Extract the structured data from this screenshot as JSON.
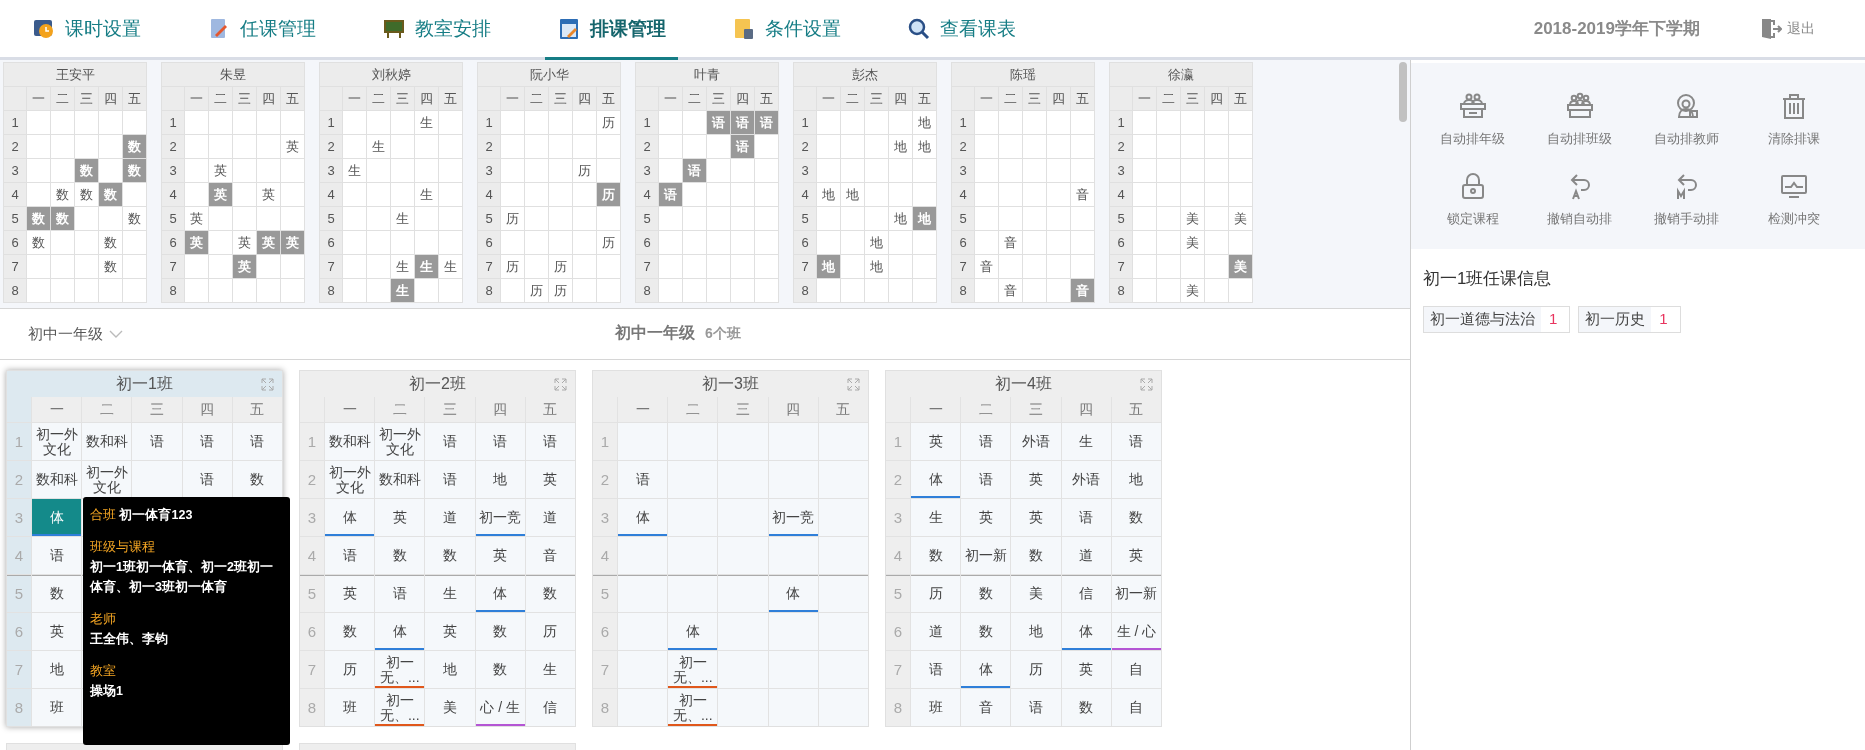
{
  "nav": {
    "tabs": [
      {
        "label": "课时设置",
        "selected": false
      },
      {
        "label": "任课管理",
        "selected": false
      },
      {
        "label": "教室安排",
        "selected": false
      },
      {
        "label": "排课管理",
        "selected": true
      },
      {
        "label": "条件设置",
        "selected": false
      },
      {
        "label": "查看课表",
        "selected": false
      }
    ],
    "term": "2018-2019学年下学期",
    "logout": "退出"
  },
  "teachers": [
    {
      "name": "王安平",
      "days": [
        "一",
        "二",
        "三",
        "四",
        "五"
      ],
      "periods": [
        "1",
        "2",
        "3",
        "4",
        "5",
        "6",
        "7",
        "8"
      ],
      "rows": [
        [
          null,
          null,
          null,
          null,
          null
        ],
        [
          null,
          null,
          null,
          null,
          {
            "text": "数",
            "highlighted": true
          }
        ],
        [
          null,
          null,
          {
            "text": "数",
            "highlighted": true
          },
          null,
          {
            "text": "数",
            "highlighted": true
          }
        ],
        [
          null,
          {
            "text": "数",
            "highlighted": false
          },
          {
            "text": "数",
            "highlighted": false
          },
          {
            "text": "数",
            "highlighted": true
          },
          null
        ],
        [
          {
            "text": "数",
            "highlighted": true
          },
          {
            "text": "数",
            "highlighted": true
          },
          null,
          null,
          {
            "text": "数",
            "highlighted": false
          }
        ],
        [
          {
            "text": "数",
            "highlighted": false
          },
          null,
          null,
          {
            "text": "数",
            "highlighted": false
          },
          null
        ],
        [
          null,
          null,
          null,
          {
            "text": "数",
            "highlighted": false
          },
          null
        ],
        [
          null,
          null,
          null,
          null,
          null
        ]
      ]
    },
    {
      "name": "朱昱",
      "days": [
        "一",
        "二",
        "三",
        "四",
        "五"
      ],
      "periods": [
        "1",
        "2",
        "3",
        "4",
        "5",
        "6",
        "7",
        "8"
      ],
      "rows": [
        [
          null,
          null,
          null,
          null,
          null
        ],
        [
          null,
          null,
          null,
          null,
          {
            "text": "英",
            "highlighted": false
          }
        ],
        [
          null,
          {
            "text": "英",
            "highlighted": false
          },
          null,
          null,
          null
        ],
        [
          null,
          {
            "text": "英",
            "highlighted": true
          },
          null,
          {
            "text": "英",
            "highlighted": false
          },
          null
        ],
        [
          {
            "text": "英",
            "highlighted": false
          },
          null,
          null,
          null,
          null
        ],
        [
          {
            "text": "英",
            "highlighted": true
          },
          null,
          {
            "text": "英",
            "highlighted": false
          },
          {
            "text": "英",
            "highlighted": true
          },
          {
            "text": "英",
            "highlighted": true
          }
        ],
        [
          null,
          null,
          {
            "text": "英",
            "highlighted": true
          },
          null,
          null
        ],
        [
          null,
          null,
          null,
          null,
          null
        ]
      ]
    },
    {
      "name": "刘秋婷",
      "days": [
        "一",
        "二",
        "三",
        "四",
        "五"
      ],
      "periods": [
        "1",
        "2",
        "3",
        "4",
        "5",
        "6",
        "7",
        "8"
      ],
      "rows": [
        [
          null,
          null,
          null,
          {
            "text": "生",
            "highlighted": false
          },
          null
        ],
        [
          null,
          {
            "text": "生",
            "highlighted": false
          },
          null,
          null,
          null
        ],
        [
          {
            "text": "生",
            "highlighted": false
          },
          null,
          null,
          null,
          null
        ],
        [
          null,
          null,
          null,
          {
            "text": "生",
            "highlighted": false
          },
          null
        ],
        [
          null,
          null,
          {
            "text": "生",
            "highlighted": false
          },
          null,
          null
        ],
        [
          null,
          null,
          null,
          null,
          null
        ],
        [
          null,
          null,
          {
            "text": "生",
            "highlighted": false
          },
          {
            "text": "生",
            "highlighted": true
          },
          {
            "text": "生",
            "highlighted": false
          }
        ],
        [
          null,
          null,
          {
            "text": "生",
            "highlighted": true
          },
          null,
          null
        ]
      ]
    },
    {
      "name": "阮小华",
      "days": [
        "一",
        "二",
        "三",
        "四",
        "五"
      ],
      "periods": [
        "1",
        "2",
        "3",
        "4",
        "5",
        "6",
        "7",
        "8"
      ],
      "rows": [
        [
          null,
          null,
          null,
          null,
          {
            "text": "历",
            "highlighted": false
          }
        ],
        [
          null,
          null,
          null,
          null,
          null
        ],
        [
          null,
          null,
          null,
          {
            "text": "历",
            "highlighted": false
          },
          null
        ],
        [
          null,
          null,
          null,
          null,
          {
            "text": "历",
            "highlighted": true
          }
        ],
        [
          {
            "text": "历",
            "highlighted": false
          },
          null,
          null,
          null,
          null
        ],
        [
          null,
          null,
          null,
          null,
          {
            "text": "历",
            "highlighted": false
          }
        ],
        [
          {
            "text": "历",
            "highlighted": false
          },
          null,
          {
            "text": "历",
            "highlighted": false
          },
          null,
          null
        ],
        [
          null,
          {
            "text": "历",
            "highlighted": false
          },
          {
            "text": "历",
            "highlighted": false
          },
          null,
          null
        ]
      ]
    },
    {
      "name": "叶青",
      "days": [
        "一",
        "二",
        "三",
        "四",
        "五"
      ],
      "periods": [
        "1",
        "2",
        "3",
        "4",
        "5",
        "6",
        "7",
        "8"
      ],
      "rows": [
        [
          null,
          null,
          {
            "text": "语",
            "highlighted": true
          },
          {
            "text": "语",
            "highlighted": true
          },
          {
            "text": "语",
            "highlighted": true
          }
        ],
        [
          null,
          null,
          null,
          {
            "text": "语",
            "highlighted": true
          },
          null
        ],
        [
          null,
          {
            "text": "语",
            "highlighted": true
          },
          null,
          null,
          null
        ],
        [
          {
            "text": "语",
            "highlighted": true
          },
          null,
          null,
          null,
          null
        ],
        [
          null,
          null,
          null,
          null,
          null
        ],
        [
          null,
          null,
          null,
          null,
          null
        ],
        [
          null,
          null,
          null,
          null,
          null
        ],
        [
          null,
          null,
          null,
          null,
          null
        ]
      ]
    },
    {
      "name": "彭杰",
      "days": [
        "一",
        "二",
        "三",
        "四",
        "五"
      ],
      "periods": [
        "1",
        "2",
        "3",
        "4",
        "5",
        "6",
        "7",
        "8"
      ],
      "rows": [
        [
          null,
          null,
          null,
          null,
          {
            "text": "地",
            "highlighted": false
          }
        ],
        [
          null,
          null,
          null,
          {
            "text": "地",
            "highlighted": false
          },
          {
            "text": "地",
            "highlighted": false
          }
        ],
        [
          null,
          null,
          null,
          null,
          null
        ],
        [
          {
            "text": "地",
            "highlighted": false
          },
          {
            "text": "地",
            "highlighted": false
          },
          null,
          null,
          null
        ],
        [
          null,
          null,
          null,
          {
            "text": "地",
            "highlighted": false
          },
          {
            "text": "地",
            "highlighted": true
          }
        ],
        [
          null,
          null,
          {
            "text": "地",
            "highlighted": false
          },
          null,
          null
        ],
        [
          {
            "text": "地",
            "highlighted": true
          },
          null,
          {
            "text": "地",
            "highlighted": false
          },
          null,
          null
        ],
        [
          null,
          null,
          null,
          null,
          null
        ]
      ]
    },
    {
      "name": "陈瑶",
      "days": [
        "一",
        "二",
        "三",
        "四",
        "五"
      ],
      "periods": [
        "1",
        "2",
        "3",
        "4",
        "5",
        "6",
        "7",
        "8"
      ],
      "rows": [
        [
          null,
          null,
          null,
          null,
          null
        ],
        [
          null,
          null,
          null,
          null,
          null
        ],
        [
          null,
          null,
          null,
          null,
          null
        ],
        [
          null,
          null,
          null,
          null,
          {
            "text": "音",
            "highlighted": false
          }
        ],
        [
          null,
          null,
          null,
          null,
          null
        ],
        [
          null,
          {
            "text": "音",
            "highlighted": false
          },
          null,
          null,
          null
        ],
        [
          {
            "text": "音",
            "highlighted": false
          },
          null,
          null,
          null,
          null
        ],
        [
          null,
          {
            "text": "音",
            "highlighted": false
          },
          null,
          null,
          {
            "text": "音",
            "highlighted": true
          }
        ]
      ]
    },
    {
      "name": "徐瀛",
      "days": [
        "一",
        "二",
        "三",
        "四",
        "五"
      ],
      "periods": [
        "1",
        "2",
        "3",
        "4",
        "5",
        "6",
        "7",
        "8"
      ],
      "rows": [
        [
          null,
          null,
          null,
          null,
          null
        ],
        [
          null,
          null,
          null,
          null,
          null
        ],
        [
          null,
          null,
          null,
          null,
          null
        ],
        [
          null,
          null,
          null,
          null,
          null
        ],
        [
          null,
          null,
          {
            "text": "美",
            "highlighted": false
          },
          null,
          {
            "text": "美",
            "highlighted": false
          }
        ],
        [
          null,
          null,
          {
            "text": "美",
            "highlighted": false
          },
          null,
          null
        ],
        [
          null,
          null,
          null,
          null,
          {
            "text": "美",
            "highlighted": true
          }
        ],
        [
          null,
          null,
          {
            "text": "美",
            "highlighted": false
          },
          null,
          null
        ]
      ]
    }
  ],
  "grade_bar": {
    "dropdown": "初中一年级",
    "title": "初中一年级",
    "count": "6个班"
  },
  "classes": [
    {
      "title": "初一1班",
      "selected": true,
      "days": [
        "一",
        "二",
        "三",
        "四",
        "五"
      ],
      "periods": [
        "1",
        "2",
        "3",
        "4",
        "5",
        "6",
        "7",
        "8"
      ],
      "rows": [
        [
          {
            "text": "初一外文化"
          },
          {
            "text": "数和科"
          },
          {
            "text": "语"
          },
          {
            "text": "语"
          },
          {
            "text": "语"
          }
        ],
        [
          {
            "text": "数和科"
          },
          {
            "text": "初一外文化"
          },
          null,
          {
            "text": "语"
          },
          {
            "text": "数"
          }
        ],
        [
          {
            "text": "体",
            "color": "#2f7fd9",
            "selected": true
          },
          null,
          null,
          null,
          null
        ],
        [
          {
            "text": "语"
          },
          null,
          null,
          null,
          null
        ],
        [
          {
            "text": "数"
          },
          null,
          null,
          null,
          null
        ],
        [
          {
            "text": "英"
          },
          null,
          null,
          null,
          null
        ],
        [
          {
            "text": "地"
          },
          null,
          null,
          null,
          null
        ],
        [
          {
            "text": "班"
          },
          null,
          null,
          null,
          null
        ]
      ],
      "tooltip": [
        {
          "label": "合班",
          "value": "初一体育123",
          "inline": true
        },
        {
          "label": "班级与课程",
          "value": "初一1班初一体育、初一2班初一体育、初一3班初一体育",
          "inline": false
        },
        {
          "label": "老师",
          "value": "王全伟、李钧",
          "inline": false
        },
        {
          "label": "教室",
          "value": "操场1",
          "inline": false
        }
      ]
    },
    {
      "title": "初一2班",
      "selected": false,
      "days": [
        "一",
        "二",
        "三",
        "四",
        "五"
      ],
      "periods": [
        "1",
        "2",
        "3",
        "4",
        "5",
        "6",
        "7",
        "8"
      ],
      "rows": [
        [
          {
            "text": "数和科"
          },
          {
            "text": "初一外文化"
          },
          {
            "text": "语"
          },
          {
            "text": "语"
          },
          {
            "text": "语"
          }
        ],
        [
          {
            "text": "初一外文化"
          },
          {
            "text": "数和科"
          },
          {
            "text": "语"
          },
          {
            "text": "地"
          },
          {
            "text": "英"
          }
        ],
        [
          {
            "text": "体",
            "color": "#2f7fd9"
          },
          {
            "text": "英"
          },
          {
            "text": "道"
          },
          {
            "text": "初一竞",
            "color": "#2f7fd9"
          },
          {
            "text": "道"
          }
        ],
        [
          {
            "text": "语"
          },
          {
            "text": "数"
          },
          {
            "text": "数"
          },
          {
            "text": "英"
          },
          {
            "text": "音"
          }
        ],
        [
          {
            "text": "英"
          },
          {
            "text": "语"
          },
          {
            "text": "生"
          },
          {
            "text": "体",
            "color": "#2f7fd9"
          },
          {
            "text": "数"
          }
        ],
        [
          {
            "text": "数"
          },
          {
            "text": "体",
            "color": "#2f7fd9"
          },
          {
            "text": "英"
          },
          {
            "text": "数"
          },
          {
            "text": "历"
          }
        ],
        [
          {
            "text": "历"
          },
          {
            "text": "初一无、...",
            "color": "#e0571b"
          },
          {
            "text": "地"
          },
          {
            "text": "数"
          },
          {
            "text": "生"
          }
        ],
        [
          {
            "text": "班"
          },
          {
            "text": "初一无、...",
            "color": "#e0571b"
          },
          {
            "text": "美"
          },
          {
            "text": "心 / 生",
            "color": "#b455d4"
          },
          {
            "text": "信"
          }
        ]
      ]
    },
    {
      "title": "初一3班",
      "selected": false,
      "days": [
        "一",
        "二",
        "三",
        "四",
        "五"
      ],
      "periods": [
        "1",
        "2",
        "3",
        "4",
        "5",
        "6",
        "7",
        "8"
      ],
      "rows": [
        [
          null,
          null,
          null,
          null,
          null
        ],
        [
          {
            "text": "语"
          },
          null,
          null,
          null,
          null
        ],
        [
          {
            "text": "体",
            "color": "#2f7fd9"
          },
          null,
          null,
          {
            "text": "初一竞",
            "color": "#2f7fd9"
          },
          null
        ],
        [
          null,
          null,
          null,
          null,
          null
        ],
        [
          null,
          null,
          null,
          {
            "text": "体",
            "color": "#2f7fd9"
          },
          null
        ],
        [
          null,
          {
            "text": "体",
            "color": "#2f7fd9"
          },
          null,
          null,
          null
        ],
        [
          null,
          {
            "text": "初一无、...",
            "color": "#e0571b"
          },
          null,
          null,
          null
        ],
        [
          null,
          {
            "text": "初一无、...",
            "color": "#e0571b"
          },
          null,
          null,
          null
        ]
      ]
    },
    {
      "title": "初一4班",
      "selected": false,
      "days": [
        "一",
        "二",
        "三",
        "四",
        "五"
      ],
      "periods": [
        "1",
        "2",
        "3",
        "4",
        "5",
        "6",
        "7",
        "8"
      ],
      "rows": [
        [
          {
            "text": "英"
          },
          {
            "text": "语"
          },
          {
            "text": "外语"
          },
          {
            "text": "生"
          },
          {
            "text": "语"
          }
        ],
        [
          {
            "text": "体",
            "color": "#2f7fd9"
          },
          {
            "text": "语"
          },
          {
            "text": "英"
          },
          {
            "text": "外语"
          },
          {
            "text": "地"
          }
        ],
        [
          {
            "text": "生"
          },
          {
            "text": "英"
          },
          {
            "text": "英"
          },
          {
            "text": "语"
          },
          {
            "text": "数"
          }
        ],
        [
          {
            "text": "数"
          },
          {
            "text": "初一新"
          },
          {
            "text": "数"
          },
          {
            "text": "道"
          },
          {
            "text": "英"
          }
        ],
        [
          {
            "text": "历"
          },
          {
            "text": "数"
          },
          {
            "text": "美"
          },
          {
            "text": "信"
          },
          {
            "text": "初一新"
          }
        ],
        [
          {
            "text": "道"
          },
          {
            "text": "数"
          },
          {
            "text": "地"
          },
          {
            "text": "体",
            "color": "#2f7fd9"
          },
          {
            "text": "生 / 心",
            "color": "#b455d4"
          }
        ],
        [
          {
            "text": "语"
          },
          {
            "text": "体",
            "color": "#2f7fd9"
          },
          {
            "text": "历"
          },
          {
            "text": "英"
          },
          {
            "text": "自"
          }
        ],
        [
          {
            "text": "班"
          },
          {
            "text": "音"
          },
          {
            "text": "语"
          },
          {
            "text": "数"
          },
          {
            "text": "自"
          }
        ]
      ]
    },
    {
      "selected": false
    },
    {
      "selected": false
    }
  ],
  "tools": [
    {
      "label": "自动排年级"
    },
    {
      "label": "自动排班级"
    },
    {
      "label": "自动排教师"
    },
    {
      "label": "清除排课"
    },
    {
      "label": "锁定课程"
    },
    {
      "label": "撤销自动排"
    },
    {
      "label": "撤销手动排"
    },
    {
      "label": "检测冲突"
    }
  ],
  "info": {
    "title": "初一1班任课信息",
    "courses": [
      {
        "name": "初一道德与法治",
        "count": "1"
      },
      {
        "name": "初一历史",
        "count": "1"
      }
    ]
  }
}
